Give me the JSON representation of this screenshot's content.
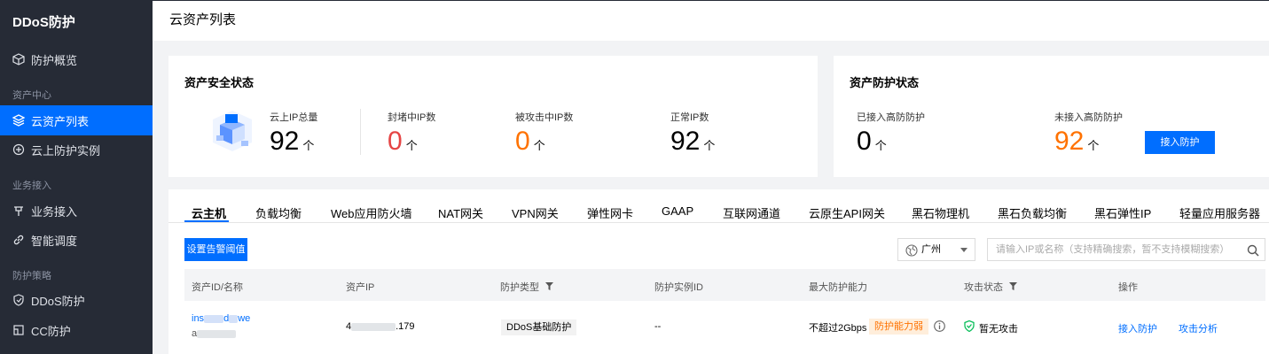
{
  "sidebar": {
    "brand": "DDoS防护",
    "items": [
      {
        "label": "防护概览"
      },
      {
        "group": "资产中心"
      },
      {
        "label": "云资产列表"
      },
      {
        "label": "云上防护实例"
      },
      {
        "group": "业务接入"
      },
      {
        "label": "业务接入"
      },
      {
        "label": "智能调度"
      },
      {
        "group": "防护策略"
      },
      {
        "label": "DDoS防护"
      },
      {
        "label": "CC防护"
      }
    ]
  },
  "header": {
    "title": "云资产列表"
  },
  "asset_security": {
    "title": "资产安全状态",
    "stats": [
      {
        "label": "云上IP总量",
        "value": "92",
        "unit": "个"
      },
      {
        "label": "封堵中IP数",
        "value": "0",
        "unit": "个"
      },
      {
        "label": "被攻击中IP数",
        "value": "0",
        "unit": "个"
      },
      {
        "label": "正常IP数",
        "value": "92",
        "unit": "个"
      }
    ]
  },
  "asset_protection": {
    "title": "资产防护状态",
    "stats": [
      {
        "label": "已接入高防防护",
        "value": "0",
        "unit": "个"
      },
      {
        "label": "未接入高防防护",
        "value": "92",
        "unit": "个"
      }
    ],
    "button": "接入防护"
  },
  "tabs": [
    "云主机",
    "负载均衡",
    "Web应用防火墙",
    "NAT网关",
    "VPN网关",
    "弹性网卡",
    "GAAP",
    "互联网通道",
    "云原生API网关",
    "黑石物理机",
    "黑石负载均衡",
    "黑石弹性IP",
    "轻量应用服务器"
  ],
  "toolbar": {
    "alert_button": "设置告警阈值",
    "region": "广州",
    "search_placeholder": "请输入IP或名称（支持精确搜索，暂不支持模糊搜索）"
  },
  "table": {
    "columns": [
      "资产ID/名称",
      "资产IP",
      "防护类型",
      "防护实例ID",
      "最大防护能力",
      "攻击状态",
      "操作"
    ],
    "rows": [
      {
        "id_prefix": "ins",
        "id_mid": "d",
        "id_suffix": "we",
        "name_prefix": "a",
        "ip_prefix": "4",
        "ip_suffix": ".179",
        "protection_type": "DDoS基础防护",
        "instance_id": "--",
        "max_capacity": "不超过2Gbps",
        "capacity_tag": "防护能力弱",
        "attack_status": "暂无攻击",
        "action_connect": "接入防护",
        "action_analysis": "攻击分析"
      }
    ]
  },
  "colors": {
    "accent": "#006eff",
    "sidebar_bg": "#262b36",
    "danger": "#e54545",
    "warning": "#ff7200",
    "success": "#0abf5b"
  }
}
